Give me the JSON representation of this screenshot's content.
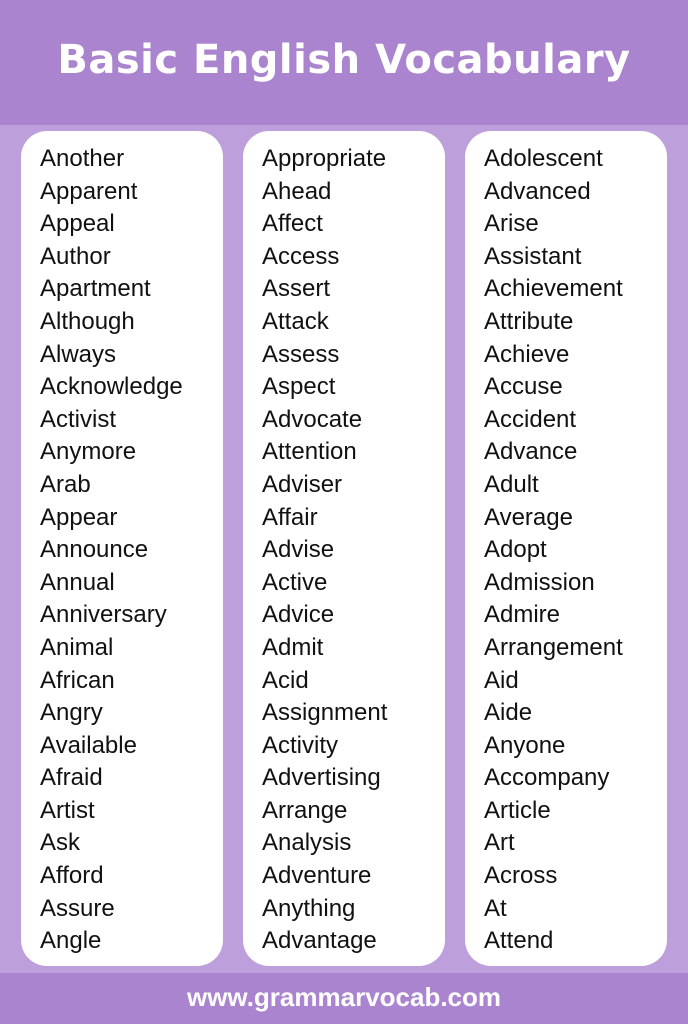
{
  "header": {
    "title": "Basic English Vocabulary"
  },
  "colors": {
    "header_bg": "#ab84d0",
    "body_bg": "#bd9fdb",
    "card_bg": "#ffffff",
    "text": "#111111",
    "title_text": "#ffffff"
  },
  "columns": [
    {
      "words": [
        "Another",
        "Apparent",
        "Appeal",
        "Author",
        "Apartment",
        "Although",
        "Always",
        "Acknowledge",
        "Activist",
        "Anymore",
        "Arab",
        "Appear",
        "Announce",
        "Annual",
        "Anniversary",
        "Animal",
        "African",
        "Angry",
        "Available",
        "Afraid",
        "Artist",
        "Ask",
        "Afford",
        "Assure",
        "Angle"
      ]
    },
    {
      "words": [
        "Appropriate",
        "Ahead",
        "Affect",
        "Access",
        "Assert",
        "Attack",
        "Assess",
        "Aspect",
        "Advocate",
        "Attention",
        "Adviser",
        "Affair",
        "Advise",
        "Active",
        "Advice",
        "Admit",
        "Acid",
        "Assignment",
        "Activity",
        "Advertising",
        "Arrange",
        "Analysis",
        "Adventure",
        "Anything",
        "Advantage"
      ]
    },
    {
      "words": [
        "Adolescent",
        "Advanced",
        "Arise",
        "Assistant",
        "Achievement",
        "Attribute",
        "Achieve",
        "Accuse",
        "Accident",
        "Advance",
        "Adult",
        "Average",
        "Adopt",
        "Admission",
        "Admire",
        "Arrangement",
        "Aid",
        "Aide",
        "Anyone",
        "Accompany",
        "Article",
        "Art",
        "Across",
        "At",
        "Attend"
      ]
    }
  ],
  "footer": {
    "url": "www.grammarvocab.com"
  }
}
